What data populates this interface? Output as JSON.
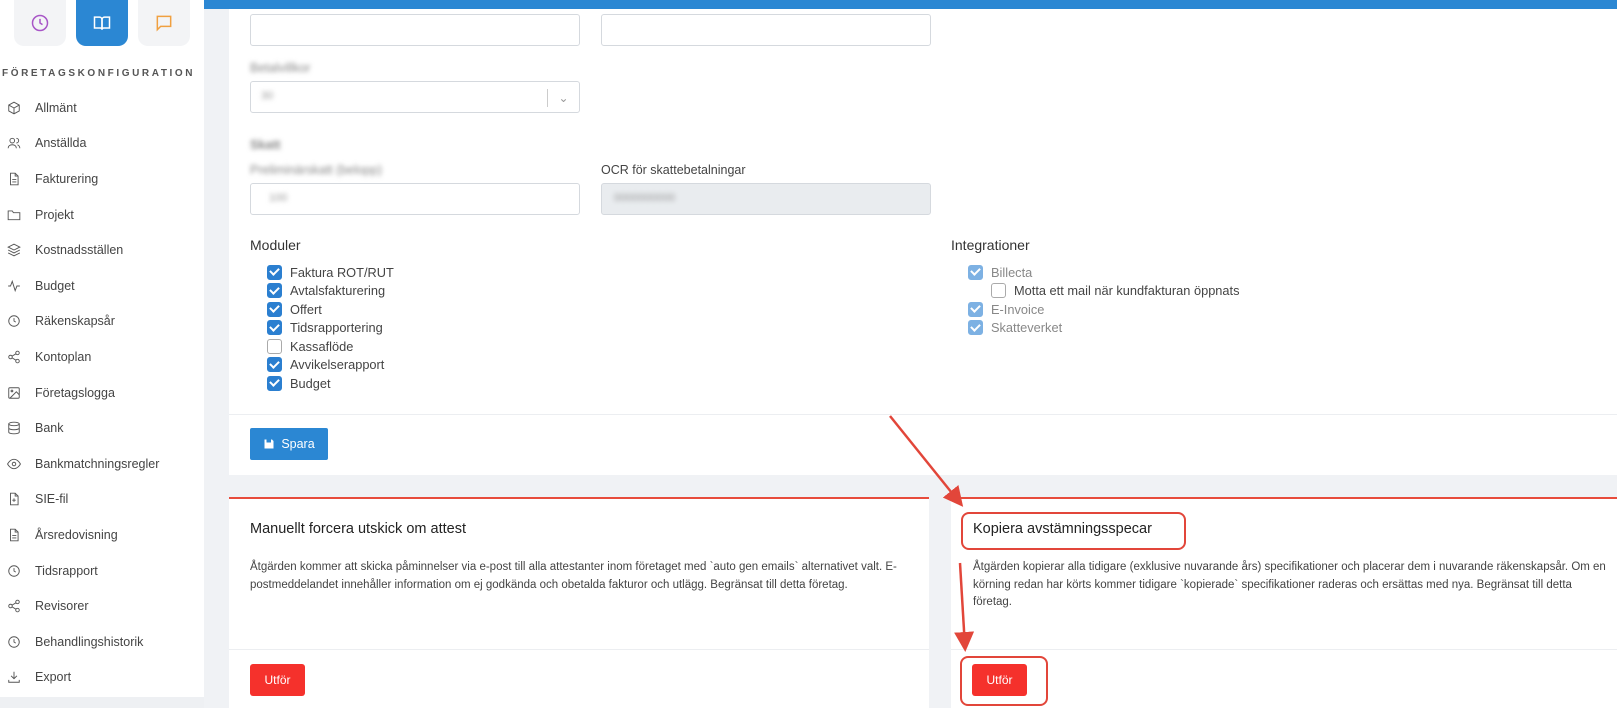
{
  "sidebar": {
    "section_title": "FÖRETAGSKONFIGURATION",
    "top_icons": [
      "clock-icon",
      "book-icon",
      "chat-icon"
    ],
    "items": [
      {
        "label": "Allmänt",
        "icon": "cube-icon"
      },
      {
        "label": "Anställda",
        "icon": "users-icon"
      },
      {
        "label": "Fakturering",
        "icon": "document-icon"
      },
      {
        "label": "Projekt",
        "icon": "folder-icon"
      },
      {
        "label": "Kostnadsställen",
        "icon": "layers-icon"
      },
      {
        "label": "Budget",
        "icon": "activity-icon"
      },
      {
        "label": "Räkenskapsår",
        "icon": "clock-icon"
      },
      {
        "label": "Kontoplan",
        "icon": "share-icon"
      },
      {
        "label": "Företagslogga",
        "icon": "image-icon"
      },
      {
        "label": "Bank",
        "icon": "database-icon"
      },
      {
        "label": "Bankmatchningsregler",
        "icon": "eye-icon"
      },
      {
        "label": "SIE-fil",
        "icon": "file-plus-icon"
      },
      {
        "label": "Årsredovisning",
        "icon": "document-icon"
      },
      {
        "label": "Tidsrapport",
        "icon": "clock-icon"
      },
      {
        "label": "Revisorer",
        "icon": "share-icon"
      },
      {
        "label": "Behandlingshistorik",
        "icon": "clock-icon"
      },
      {
        "label": "Export",
        "icon": "download-icon"
      }
    ]
  },
  "form": {
    "payment_label_blurred": "Betalvillkor",
    "payment_value_blurred": "30",
    "tax_heading_blurred": "Skatt",
    "prelim_tax_label_blurred": "Preliminärskatt (belopp)",
    "prelim_tax_value_blurred": "100",
    "ocr_label": "OCR för skattebetalningar",
    "ocr_value_blurred": "0000000000"
  },
  "modules": {
    "title": "Moduler",
    "items": [
      {
        "label": "Faktura ROT/RUT",
        "checked": true
      },
      {
        "label": "Avtalsfakturering",
        "checked": true
      },
      {
        "label": "Offert",
        "checked": true
      },
      {
        "label": "Tidsrapportering",
        "checked": true
      },
      {
        "label": "Kassaflöde",
        "checked": false
      },
      {
        "label": "Avvikelserapport",
        "checked": true
      },
      {
        "label": "Budget",
        "checked": true
      }
    ]
  },
  "integrations": {
    "title": "Integrationer",
    "items": [
      {
        "label": "Billecta",
        "checked": true,
        "disabled": true
      },
      {
        "label": "Motta ett mail när kundfakturan öppnats",
        "checked": false,
        "disabled": false
      },
      {
        "label": "E-Invoice",
        "checked": true,
        "disabled": true
      },
      {
        "label": "Skatteverket",
        "checked": true,
        "disabled": true
      }
    ]
  },
  "save_button": "Spara",
  "attest_card": {
    "title": "Manuellt forcera utskick om attest",
    "text": "Åtgärden kommer att skicka påminnelser via e-post till alla attestanter inom företaget med `auto gen emails` alternativet valt. E-postmeddelandet innehåller information om ej godkända och obetalda fakturor och utlägg. Begränsat till detta företag.",
    "button": "Utför"
  },
  "copy_card": {
    "title": "Kopiera avstämningsspecar",
    "text": "Åtgärden kopierar alla tidigare (exklusive nuvarande års) specifikationer och placerar dem i nuvarande räkenskapsår. Om en körning redan har körts kommer tidigare `kopierade` specifikationer raderas och ersättas med nya. Begränsat till detta företag.",
    "button": "Utför"
  },
  "colors": {
    "primary": "#2b87d3",
    "danger": "#f5312c",
    "annotation": "#e2463a"
  }
}
